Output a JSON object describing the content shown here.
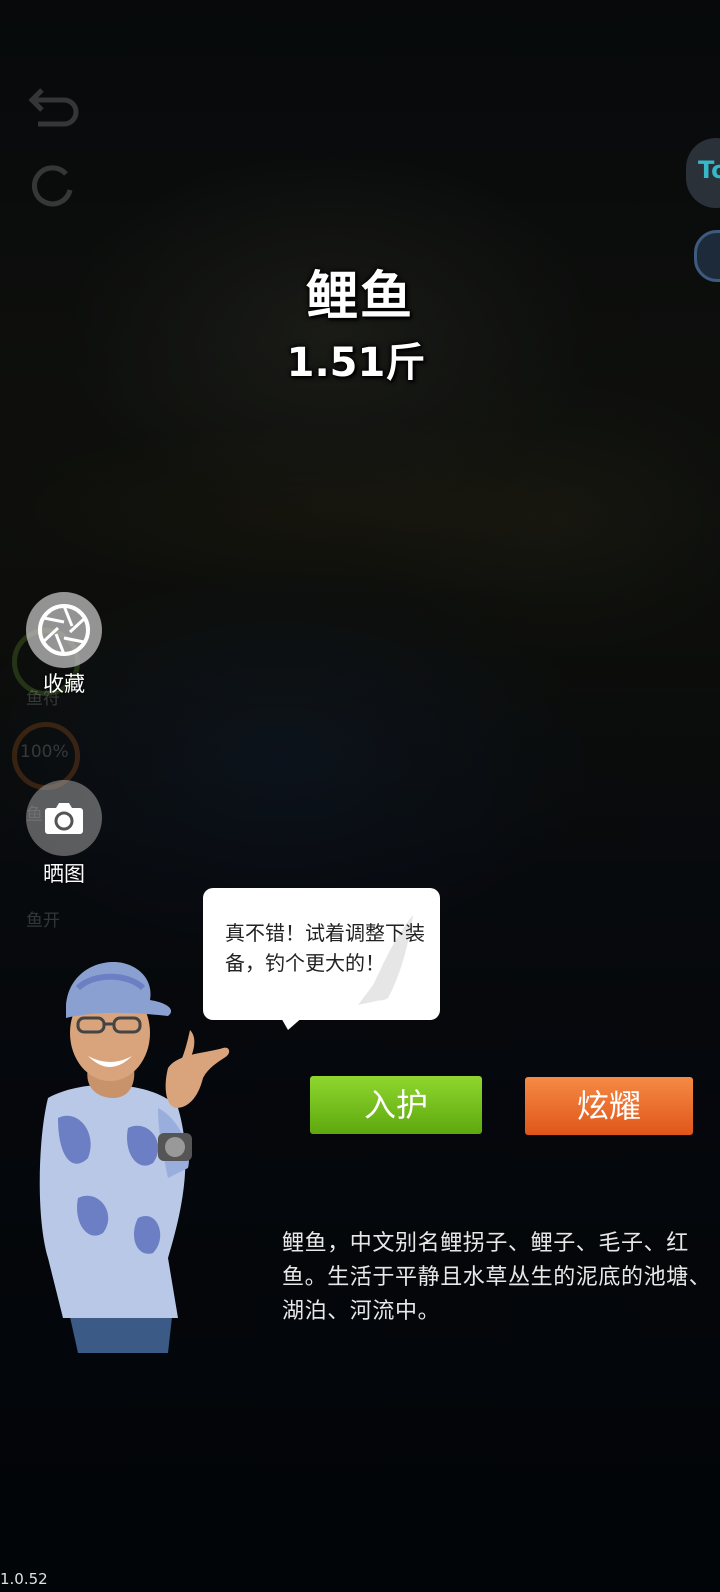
{
  "fish": {
    "name": "鲤鱼",
    "weight": "1.51斤"
  },
  "side_buttons": {
    "collect_label": "收藏",
    "share_label": "晒图"
  },
  "background_hud": {
    "labels": [
      "鱼符",
      "100%",
      "鱼",
      "鱼开"
    ],
    "badge_text": "To"
  },
  "dialog": {
    "message": "真不错！试着调整下装备，钓个更大的！"
  },
  "actions": {
    "protect_label": "入护",
    "show_label": "炫耀"
  },
  "description": "鲤鱼，中文别名鲤拐子、鲤子、毛子、红鱼。生活于平静且水草丛生的泥底的池塘、湖泊、河流中。",
  "version": "1.0.52",
  "colors": {
    "protect_button": "#6fbe17",
    "show_button": "#ec6b2c",
    "badge_text": "#36b8c8"
  }
}
